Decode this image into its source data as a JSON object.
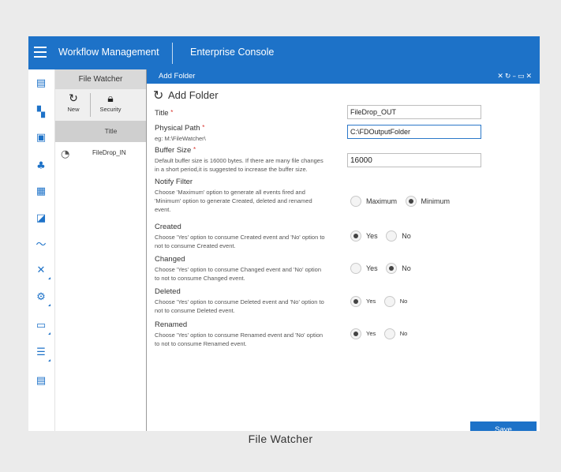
{
  "header": {
    "app_title": "Workflow Management",
    "console_title": "Enterprise Console"
  },
  "rail_icons": [
    "list-icon",
    "dashboard-icon",
    "monitor-icon",
    "sitemap-icon",
    "calendar-icon",
    "report-icon",
    "trend-icon",
    "tools-icon",
    "settings-icon",
    "inbox-icon",
    "menu-list-icon",
    "document-icon"
  ],
  "file_watcher": {
    "heading": "File Watcher",
    "new_label": "New",
    "security_label": "Security",
    "column_title": "Title",
    "rows": [
      {
        "title": "FileDrop_IN"
      }
    ]
  },
  "add_folder": {
    "panel_title": "Add Folder",
    "form_title": "Add Folder",
    "title_label": "Title",
    "title_value": "FileDrop_OUT",
    "path_label": "Physical Path",
    "path_example": "eg: M:\\FileWatcher\\",
    "path_value": "C:\\FDOutputFolder",
    "buffer_label": "Buffer Size",
    "buffer_hint_1": "Default buffer size is 16000 bytes. If there are many file changes",
    "buffer_hint_2": "in a short period,it is suggested to increase the buffer size.",
    "buffer_value": "16000",
    "notify_label": "Notify Filter",
    "notify_hint_1": "Choose 'Maximum' option to generate all events fired and",
    "notify_hint_2": "'Minimum' option to generate Created, deleted and renamed",
    "notify_hint_3": "event.",
    "notify_opt_max": "Maximum",
    "notify_opt_min": "Minimum",
    "notify_selected": "Minimum",
    "created_label": "Created",
    "created_hint_1": "Choose 'Yes' option to consume Created event and 'No' option to",
    "created_hint_2": "not to consume Created event.",
    "created_selected": "Yes",
    "changed_label": "Changed",
    "changed_hint_1": "Choose 'Yes' option to consume Changed event and 'No' option",
    "changed_hint_2": "to not to consume Changed event.",
    "changed_selected": "No",
    "deleted_label": "Deleted",
    "deleted_hint_1": "Choose 'Yes' option to consume Deleted event and 'No' option to",
    "deleted_hint_2": "not to consume Deleted event.",
    "deleted_selected": "Yes",
    "renamed_label": "Renamed",
    "renamed_hint_1": "Choose 'Yes' option to consume Renamed event and 'No' option",
    "renamed_hint_2": "to not to consume Renamed event.",
    "renamed_selected": "Yes",
    "yes_label": "Yes",
    "no_label": "No",
    "save_label": "Save"
  },
  "caption": "File Watcher",
  "colors": {
    "primary": "#1d72c8",
    "required": "#d9312b"
  }
}
